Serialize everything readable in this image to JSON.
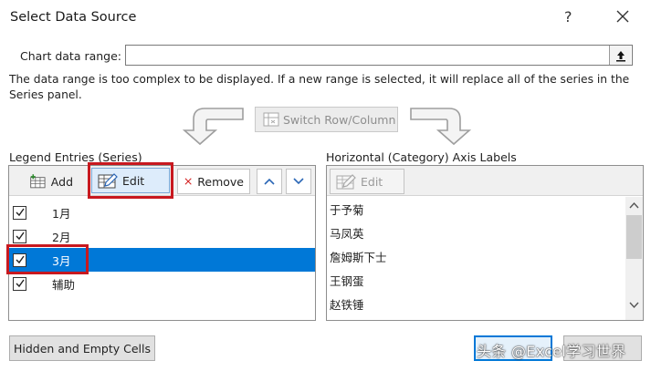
{
  "window": {
    "title": "Select Data Source",
    "help": "?"
  },
  "range": {
    "label": "Chart data range:",
    "value": ""
  },
  "notice": "The data range is too complex to be displayed. If a new range is selected, it will replace all of the series in the Series panel.",
  "switch_label": "Switch Row/Column",
  "legend": {
    "title": "Legend Entries (Series)",
    "add": "Add",
    "edit": "Edit",
    "remove": "Remove",
    "series": [
      {
        "label": "1月",
        "checked": true
      },
      {
        "label": "2月",
        "checked": true
      },
      {
        "label": "3月",
        "checked": true,
        "selected": true
      },
      {
        "label": "辅助",
        "checked": true
      }
    ]
  },
  "axis": {
    "title": "Horizontal (Category) Axis Labels",
    "edit": "Edit",
    "items": [
      "于予菊",
      "马凤英",
      "詹姆斯下士",
      "王钢蛋",
      "赵铁锤"
    ]
  },
  "footer": {
    "hidden_cells": "Hidden and Empty Cells"
  },
  "watermark": "头条 @Excel学习世界",
  "colors": {
    "selection": "#0078d7",
    "highlight": "#c8191f"
  }
}
